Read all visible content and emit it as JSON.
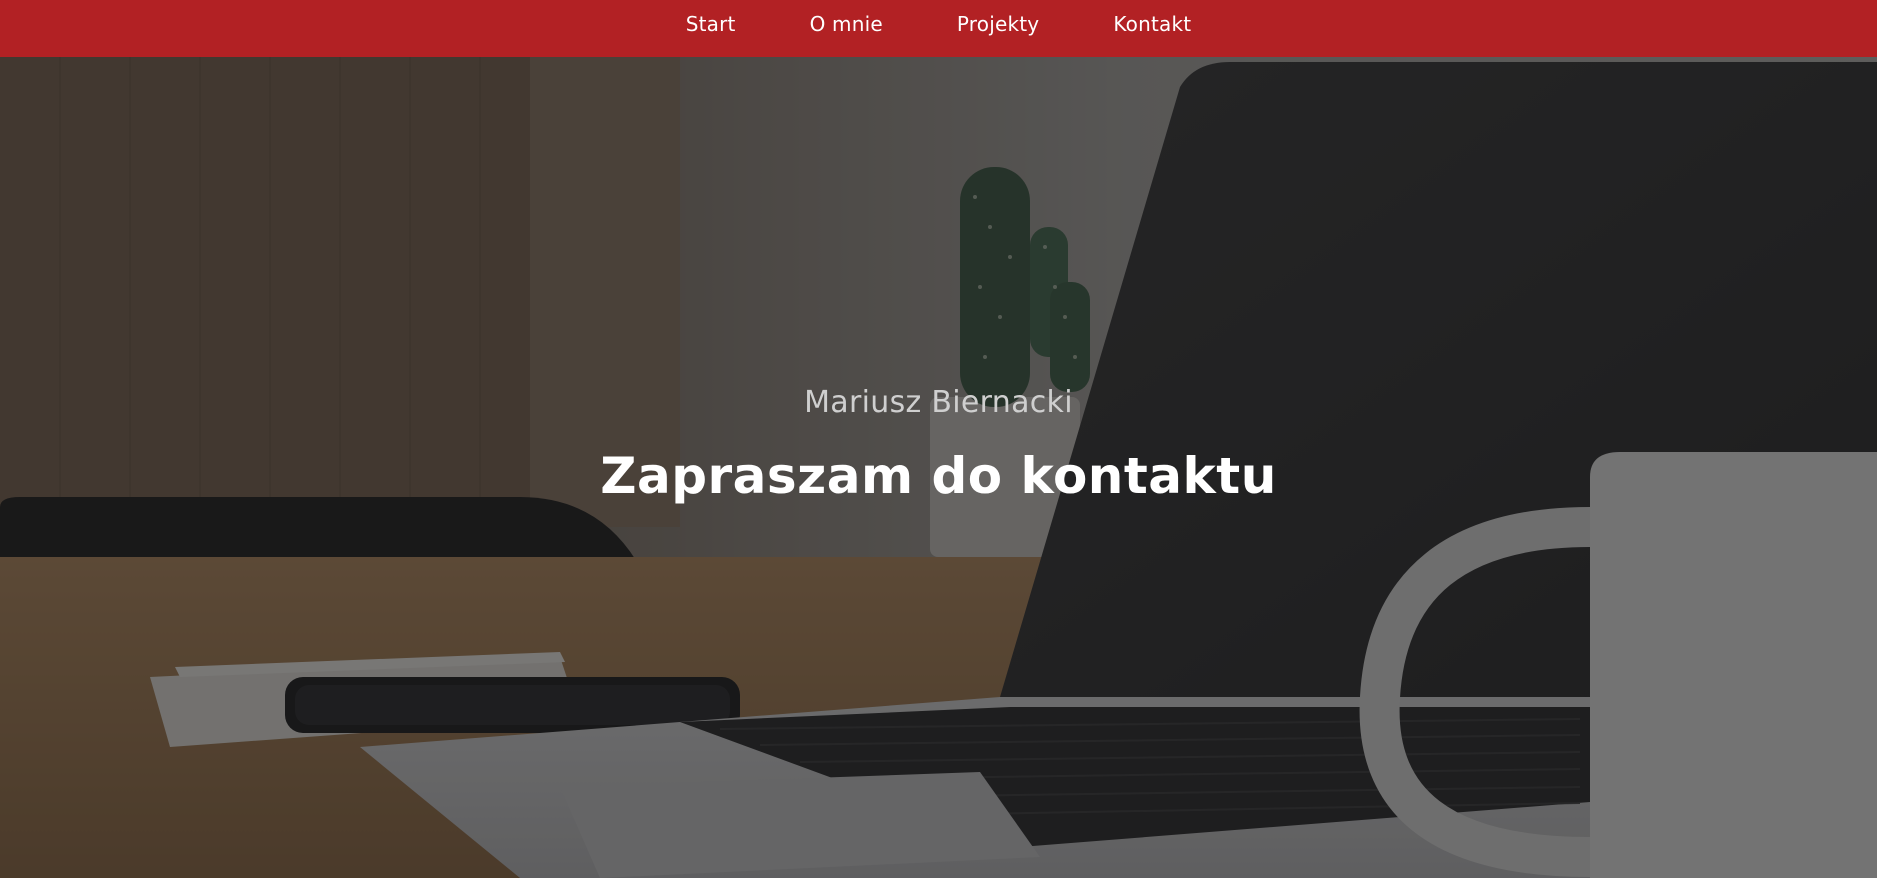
{
  "nav": {
    "items": [
      {
        "label": "Start"
      },
      {
        "label": "O mnie"
      },
      {
        "label": "Projekty"
      },
      {
        "label": "Kontakt"
      }
    ]
  },
  "hero": {
    "name": "Mariusz Biernacki",
    "title": "Zapraszam do kontaktu"
  },
  "colors": {
    "navbar": "#b22124",
    "overlay": "#141414",
    "text_primary": "#ffffff",
    "text_secondary": "#cfcfcf"
  }
}
